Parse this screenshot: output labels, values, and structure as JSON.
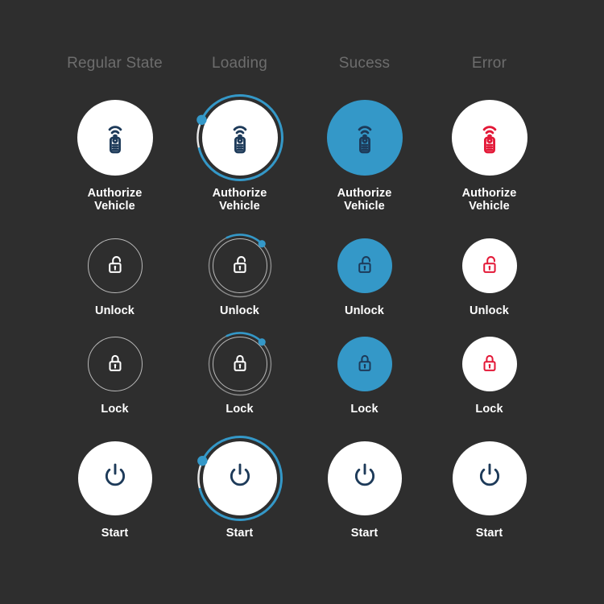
{
  "background_color": "#2e2e2e",
  "palette": {
    "accent_blue": "#3498c8",
    "icon_navy": "#1d3a59",
    "error_red": "#e31837",
    "white": "#ffffff",
    "outline_gray": "#b9b9b9",
    "header_gray": "#6d6d6d",
    "ring_track": "#e9e9e9"
  },
  "columns": [
    {
      "id": "regular",
      "label": "Regular\nState"
    },
    {
      "id": "loading",
      "label": "Loading"
    },
    {
      "id": "success",
      "label": "Sucess"
    },
    {
      "id": "error",
      "label": "Error"
    }
  ],
  "rows": [
    {
      "id": "authorize-vehicle",
      "label": "Authorize\nVehicle",
      "icon": "key-fob-signal-icon",
      "size": "lg",
      "cells": [
        {
          "state": "regular",
          "fill": "white",
          "icon_color": "#1d3a59",
          "ring": "none"
        },
        {
          "state": "loading",
          "fill": "white",
          "icon_color": "#1d3a59",
          "ring": "long",
          "ring_start_deg": 295,
          "ring_sweep_deg": 320
        },
        {
          "state": "success",
          "fill": "blue",
          "icon_color": "#1d3a59",
          "ring": "none"
        },
        {
          "state": "error",
          "fill": "white",
          "icon_color": "#e31837",
          "ring": "none"
        }
      ]
    },
    {
      "id": "unlock",
      "label": "Unlock",
      "icon": "padlock-open-icon",
      "size": "md",
      "cells": [
        {
          "state": "regular",
          "fill": "none",
          "icon_color": "#ffffff",
          "ring": "none"
        },
        {
          "state": "loading",
          "fill": "none",
          "icon_color": "#ffffff",
          "ring": "short",
          "ring_start_deg": 335,
          "ring_sweep_deg": 70
        },
        {
          "state": "success",
          "fill": "blue",
          "icon_color": "#1d3a59",
          "ring": "none"
        },
        {
          "state": "error",
          "fill": "white",
          "icon_color": "#e31837",
          "ring": "none"
        }
      ]
    },
    {
      "id": "lock",
      "label": "Lock",
      "icon": "padlock-closed-icon",
      "size": "md",
      "cells": [
        {
          "state": "regular",
          "fill": "none",
          "icon_color": "#ffffff",
          "ring": "none"
        },
        {
          "state": "loading",
          "fill": "none",
          "icon_color": "#ffffff",
          "ring": "short",
          "ring_start_deg": 335,
          "ring_sweep_deg": 70
        },
        {
          "state": "success",
          "fill": "blue",
          "icon_color": "#1d3a59",
          "ring": "none"
        },
        {
          "state": "error",
          "fill": "white",
          "icon_color": "#e31837",
          "ring": "none"
        }
      ]
    },
    {
      "id": "start",
      "label": "Start",
      "icon": "power-icon",
      "size": "xl",
      "cells": [
        {
          "state": "regular",
          "fill": "white",
          "icon_color": "#1d3a59",
          "ring": "none"
        },
        {
          "state": "loading",
          "fill": "white",
          "icon_color": "#1d3a59",
          "ring": "long",
          "ring_start_deg": 295,
          "ring_sweep_deg": 320
        },
        {
          "state": "success",
          "fill": "white",
          "icon_color": "#1d3a59",
          "ring": "none"
        },
        {
          "state": "error",
          "fill": "white",
          "icon_color": "#1d3a59",
          "ring": "none"
        }
      ]
    }
  ]
}
